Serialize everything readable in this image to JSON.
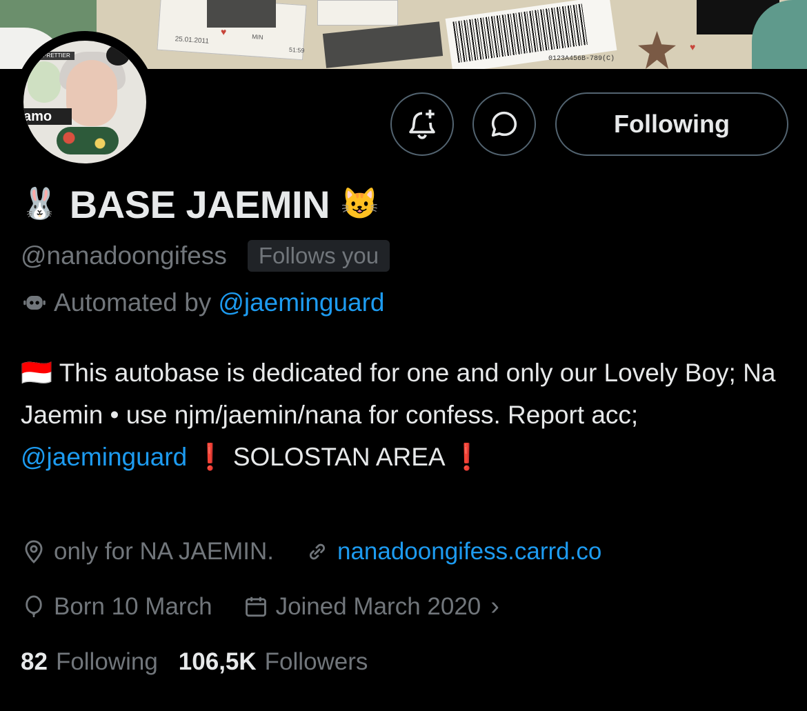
{
  "header": {
    "banner_label": "0123A456B-789(C)",
    "banner_date": "25.01.2011",
    "banner_time": "51:59",
    "banner_min": "MIN"
  },
  "profile": {
    "name": "BASE JAEMIN",
    "name_prefix_emoji": "🐰",
    "name_suffix_emoji": "😺",
    "handle": "@nanadoongifess",
    "follows_you": "Follows you",
    "automated_prefix": "Automated by",
    "automated_link": "@jaeminguard",
    "avatar_tag": "PRETTIER",
    "avatar_word": "amo"
  },
  "actions": {
    "notify_icon": "bell-plus-icon",
    "message_icon": "message-bubble-icon",
    "follow_label": "Following"
  },
  "bio": {
    "flag": "🇮🇩",
    "part1": "This autobase is dedicated for one and only our Lovely Boy; Na Jaemin • use njm/jaemin/nana for confess. Report acc;",
    "link": "@jaeminguard",
    "excl1": "❗",
    "part2": "SOLOSTAN AREA",
    "excl2": "❗"
  },
  "meta": {
    "location": "only for NA JAEMIN.",
    "website": "nanadoongifess.carrd.co",
    "birthday": "Born 10 March",
    "joined": "Joined March 2020",
    "joined_chevron": "›"
  },
  "stats": {
    "following_count": "82",
    "following_label": "Following",
    "followers_count": "106,5K",
    "followers_label": "Followers"
  },
  "colors": {
    "background": "#000000",
    "text": "#e7e9ea",
    "muted": "#71767b",
    "link": "#1d9bf0",
    "border": "#536471"
  }
}
